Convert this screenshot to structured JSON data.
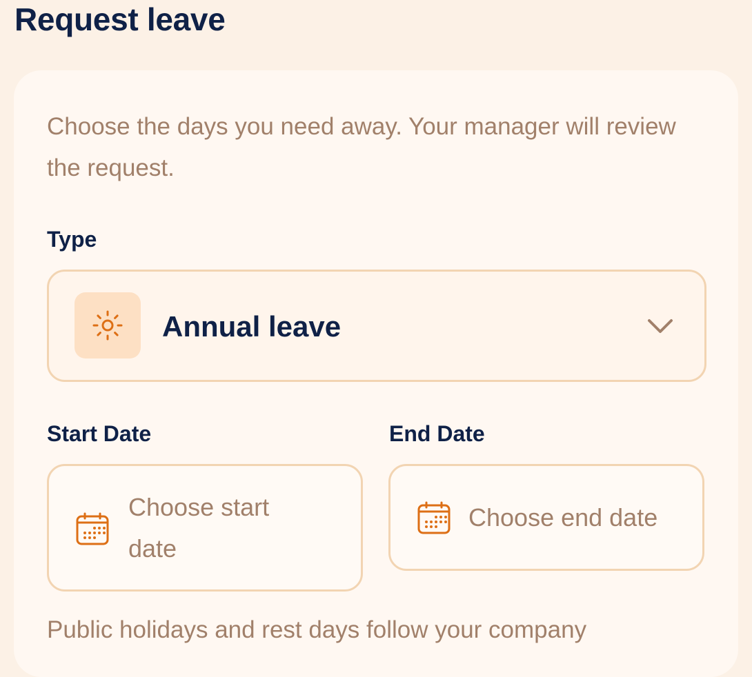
{
  "page": {
    "title": "Request leave"
  },
  "form": {
    "intro": "Choose the days you need away. Your manager will review the request.",
    "type": {
      "label": "Type",
      "selected": "Annual leave",
      "icon": "sun-icon"
    },
    "start_date": {
      "label": "Start Date",
      "placeholder": "Choose start date",
      "icon": "calendar-icon"
    },
    "end_date": {
      "label": "End Date",
      "placeholder": "Choose end date",
      "icon": "calendar-icon"
    },
    "footnote": "Public holidays and rest days follow your company"
  },
  "colors": {
    "background": "#fcf1e6",
    "card": "#fff8f2",
    "title": "#0f2147",
    "muted_text": "#a1806a",
    "border": "#f2d4b2",
    "accent": "#dd6f15",
    "icon_bg": "#fde0c4"
  }
}
